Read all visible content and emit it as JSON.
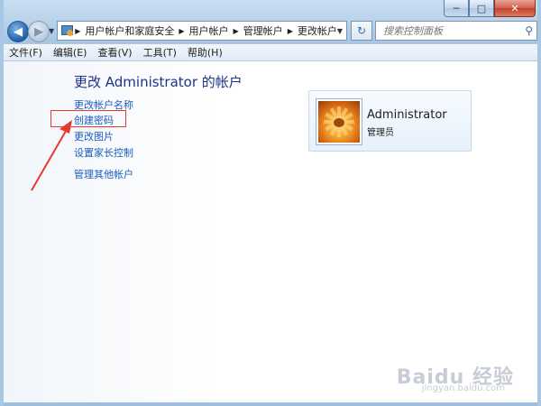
{
  "window": {
    "caption_buttons": {
      "minimize": "─",
      "maximize": "□",
      "close": "✕"
    }
  },
  "nav": {
    "back_icon": "arrow-left-icon",
    "forward_icon": "arrow-right-icon",
    "address": {
      "overflow": "«",
      "crumbs": [
        "用户帐户和家庭安全",
        "用户帐户",
        "管理帐户",
        "更改帐户"
      ]
    },
    "search": {
      "placeholder": "搜索控制面板"
    }
  },
  "menubar": [
    "文件(F)",
    "编辑(E)",
    "查看(V)",
    "工具(T)",
    "帮助(H)"
  ],
  "main": {
    "heading": "更改 Administrator 的帐户",
    "tasks": [
      "更改帐户名称",
      "创建密码",
      "更改图片",
      "设置家长控制"
    ],
    "other_task": "管理其他帐户",
    "highlighted_task": "创建密码",
    "annotation_color": "#e73a2f"
  },
  "account": {
    "name": "Administrator",
    "role": "管理员",
    "avatar_icon": "flower-avatar-icon"
  },
  "watermark": {
    "brand": "Baidu 经验",
    "url": "jingyan.baidu.com"
  }
}
